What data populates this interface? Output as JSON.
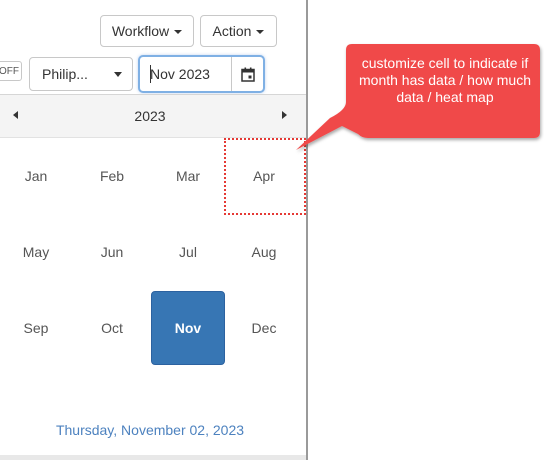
{
  "toolbar": {
    "workflow_label": "Workflow",
    "action_label": "Action"
  },
  "filters": {
    "toggle_label": "OFF",
    "select_value": "Philip...",
    "date_value": "Nov 2023"
  },
  "calendar": {
    "year": "2023",
    "months": [
      "Jan",
      "Feb",
      "Mar",
      "Apr",
      "May",
      "Jun",
      "Jul",
      "Aug",
      "Sep",
      "Oct",
      "Nov",
      "Dec"
    ],
    "selected_month": "Nov",
    "highlighted_month": "Apr",
    "footer_date": "Thursday, November 02, 2023"
  },
  "callout": {
    "text": "customize cell to indicate if month has data / how much data / heat map",
    "color": "#f04a4a"
  },
  "colors": {
    "selected": "#3776b4",
    "link": "#4d82bf",
    "highlight": "#e53935"
  },
  "icons": [
    "caret-down-icon",
    "calendar-icon",
    "chevron-left-icon",
    "chevron-right-icon"
  ]
}
